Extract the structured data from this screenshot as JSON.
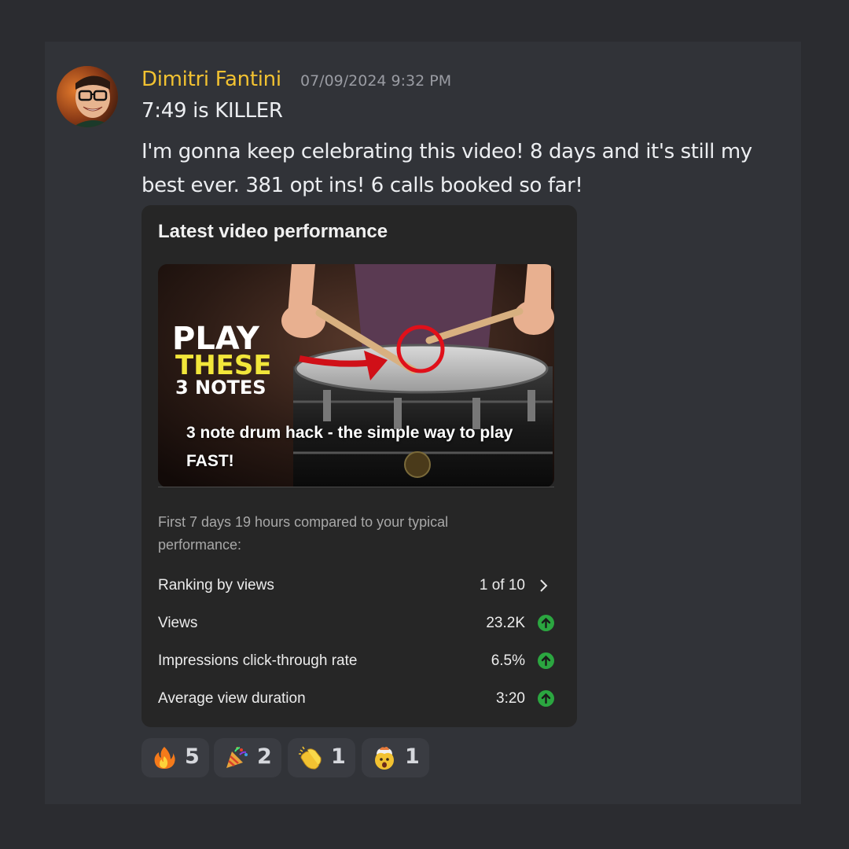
{
  "message": {
    "username": "Dimitri Fantini",
    "timestamp": "07/09/2024 9:32 PM",
    "line1": "7:49 is KILLER",
    "body": "I'm gonna keep celebrating this video!  8 days and it's still my best ever. 381 opt ins!  6 calls booked so far!"
  },
  "card": {
    "title": "Latest video performance",
    "thumbnail": {
      "text_line1": "PLAY",
      "text_line2": "THESE",
      "text_line3": "3 NOTES",
      "caption": "3 note drum hack - the simple way to play FAST!"
    },
    "compare_text": "First 7 days 19 hours compared to your typical performance:",
    "stats": [
      {
        "label": "Ranking by views",
        "value": "1 of 10",
        "icon": "chevron-right-icon"
      },
      {
        "label": "Views",
        "value": "23.2K",
        "icon": "arrow-up-icon"
      },
      {
        "label": "Impressions click-through rate",
        "value": "6.5%",
        "icon": "arrow-up-icon"
      },
      {
        "label": "Average view duration",
        "value": "3:20",
        "icon": "arrow-up-icon"
      }
    ]
  },
  "reactions": [
    {
      "emoji": "fire-icon",
      "count": "5"
    },
    {
      "emoji": "party-popper-icon",
      "count": "2"
    },
    {
      "emoji": "clapping-hands-icon",
      "count": "1"
    },
    {
      "emoji": "exploding-head-icon",
      "count": "1"
    }
  ],
  "colors": {
    "username": "#f2c231",
    "stat_up": "#2ba640",
    "background": "#313338",
    "card": "#262626"
  }
}
